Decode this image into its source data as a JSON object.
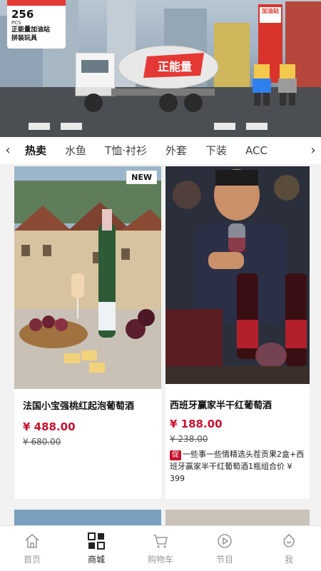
{
  "banner": {
    "piece_count": "256",
    "pcs_label": "PCS",
    "line1": "正能量加油站",
    "line2": "拼装玩具",
    "tower_sign": "加油站"
  },
  "tabs": {
    "items": [
      "热卖",
      "水鱼",
      "T恤·衬衫",
      "外套",
      "下装",
      "ACC"
    ],
    "active_index": 0
  },
  "products": [
    {
      "title": "法国小宝强桃红起泡葡萄酒",
      "price": "¥ 488.00",
      "old_price": "¥ 680.00",
      "badge": "NEW"
    },
    {
      "title": "西班牙赢家半干红葡萄酒",
      "price": "¥ 188.00",
      "old_price": "¥ 238.00",
      "promo_tag": "促",
      "promo_text": "一些事一些情精选头茬贡果2盒+西班牙赢家半干红葡萄酒1瓶组合价 ¥ 399"
    }
  ],
  "nav": {
    "items": [
      {
        "label": "首页",
        "icon": "home-icon"
      },
      {
        "label": "商城",
        "icon": "grid-icon"
      },
      {
        "label": "购物车",
        "icon": "cart-icon"
      },
      {
        "label": "节目",
        "icon": "play-icon"
      },
      {
        "label": "我",
        "icon": "profile-icon"
      }
    ],
    "active_index": 1
  },
  "colors": {
    "price_red": "#c8102e",
    "promo_red": "#c8102e",
    "active_text": "#222222",
    "inactive_text": "#999999"
  }
}
